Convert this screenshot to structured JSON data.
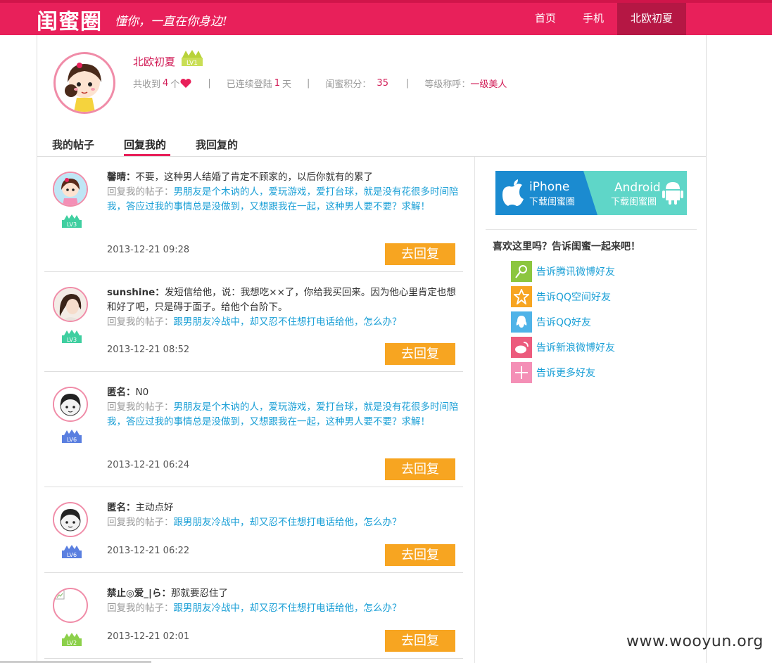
{
  "header": {
    "logo": "闺蜜圈",
    "slogan": "懂你，一直在你身边!",
    "nav": [
      "首页",
      "手机",
      "北欧初夏"
    ]
  },
  "profile": {
    "name": "北欧初夏",
    "level": "LV1",
    "received_label": "共收到",
    "received_count": "4",
    "received_unit": "个",
    "login_label": "已连续登陆",
    "login_days": "1",
    "login_unit": "天",
    "points_label": "闺蜜积分：",
    "points": "35",
    "title_label": "等级称呼：",
    "title": "一级美人"
  },
  "tabs": [
    "我的帖子",
    "回复我的",
    "我回复的"
  ],
  "replies": [
    {
      "author": "馨晴：",
      "text": "不要，这种男人结婚了肯定不顾家的，以后你就有的累了",
      "reply_label": "回复我的帖子：",
      "post": "男朋友是个木讷的人，爱玩游戏，爱打台球，就是没有花很多时间陪我，答应过我的事情总是没做到，又想跟我在一起，这种男人要不要？求解！",
      "level": "LV3",
      "time": "2013-12-21 09:28",
      "button": "去回复"
    },
    {
      "author": "sunshine：",
      "text": "发短信给他，说：我想吃××了，你给我买回来。因为他心里肯定也想和好了吧，只是碍于面子。给他个台阶下。",
      "reply_label": "回复我的帖子：",
      "post": "跟男朋友冷战中，却又忍不住想打电话给他，怎么办？",
      "level": "LV3",
      "time": "2013-12-21 08:52",
      "button": "去回复"
    },
    {
      "author": "匿名：",
      "text": "N0",
      "reply_label": "回复我的帖子：",
      "post": "男朋友是个木讷的人，爱玩游戏，爱打台球，就是没有花很多时间陪我，答应过我的事情总是没做到，又想跟我在一起，这种男人要不要？求解！",
      "level": "LV6",
      "time": "2013-12-21 06:24",
      "button": "去回复"
    },
    {
      "author": "匿名：",
      "text": "主动点好",
      "reply_label": "回复我的帖子：",
      "post": "跟男朋友冷战中，却又忍不住想打电话给他，怎么办？",
      "level": "LV6",
      "time": "2013-12-21 06:22",
      "button": "去回复"
    },
    {
      "author": "禁止◎爱_|ら：",
      "text": "那就要忍住了",
      "reply_label": "回复我的帖子：",
      "post": "跟男朋友冷战中，却又忍不住想打电话给他，怎么办？",
      "level": "LV2",
      "time": "2013-12-21 02:01",
      "button": "去回复"
    }
  ],
  "sidebar": {
    "iphone_title": "iPhone",
    "iphone_sub": "下载闺蜜圈",
    "android_title": "Android",
    "android_sub": "下载闺蜜圈",
    "share_heading": "喜欢这里吗？告诉闺蜜一起来吧！",
    "share": [
      {
        "label": "告诉腾讯微博好友",
        "icon": "tencent-weibo-icon",
        "color": "#8cc63f"
      },
      {
        "label": "告诉QQ空间好友",
        "icon": "qzone-icon",
        "color": "#f7a521"
      },
      {
        "label": "告诉QQ好友",
        "icon": "qq-icon",
        "color": "#4fb3e8"
      },
      {
        "label": "告诉新浪微博好友",
        "icon": "sina-weibo-icon",
        "color": "#ec5b7d"
      },
      {
        "label": "告诉更多好友",
        "icon": "plus-icon",
        "color": "#f48fb6"
      }
    ]
  },
  "watermark": "www.wooyun.org",
  "colors": {
    "brand": "#e8205a",
    "button": "#f7a521",
    "link": "#1a9fd6"
  }
}
